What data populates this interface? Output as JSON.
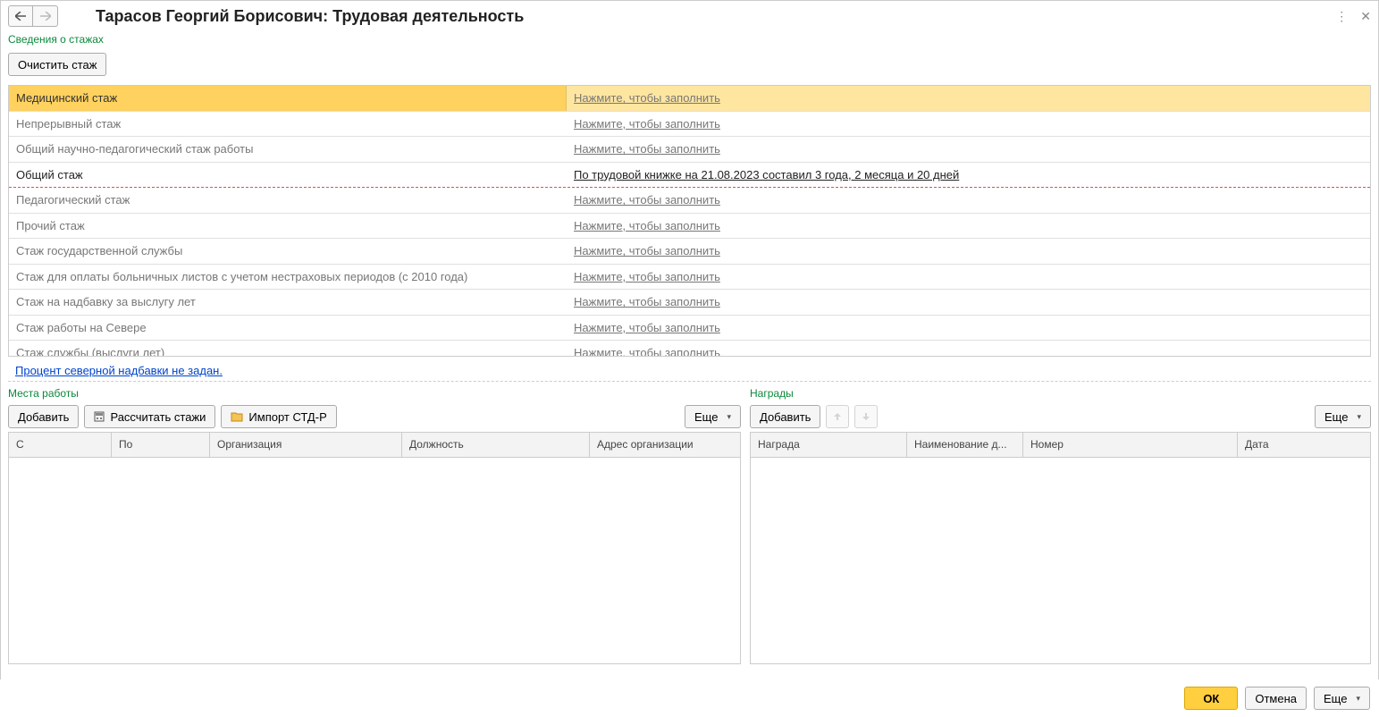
{
  "header": {
    "title": "Тарасов Георгий Борисович: Трудовая деятельность"
  },
  "stazh": {
    "section_title": "Сведения о стажах",
    "clear_button": "Очистить стаж",
    "fill_prompt": "Нажмите, чтобы заполнить",
    "rows": [
      {
        "name": "Медицинский стаж",
        "value": null,
        "selected": true
      },
      {
        "name": "Непрерывный стаж",
        "value": null
      },
      {
        "name": "Общий научно-педагогический стаж работы",
        "value": null
      },
      {
        "name": "Общий стаж",
        "value": "По трудовой книжке на 21.08.2023 составил 3 года, 2 месяца и 20 дней",
        "filled": true
      },
      {
        "name": "Педагогический стаж",
        "value": null
      },
      {
        "name": "Прочий стаж",
        "value": null
      },
      {
        "name": "Стаж государственной службы",
        "value": null
      },
      {
        "name": "Стаж для оплаты больничных листов с учетом нестраховых периодов (с 2010 года)",
        "value": null
      },
      {
        "name": "Стаж на надбавку за выслугу лет",
        "value": null
      },
      {
        "name": "Стаж работы на Севере",
        "value": null
      },
      {
        "name": "Стаж службы (выслуги лет)",
        "value": null
      }
    ],
    "warning": "Процент северной надбавки не задан."
  },
  "workplaces": {
    "section_title": "Места работы",
    "add_button": "Добавить",
    "calc_button": "Рассчитать стажи",
    "import_button": "Импорт СТД-Р",
    "more_button": "Еще",
    "columns": {
      "from": "С",
      "to": "По",
      "org": "Организация",
      "position": "Должность",
      "address": "Адрес организации"
    }
  },
  "awards": {
    "section_title": "Награды",
    "add_button": "Добавить",
    "more_button": "Еще",
    "columns": {
      "award": "Награда",
      "doc_name": "Наименование д...",
      "number": "Номер",
      "date": "Дата"
    }
  },
  "footer": {
    "ok": "ОК",
    "cancel": "Отмена",
    "more": "Еще"
  }
}
